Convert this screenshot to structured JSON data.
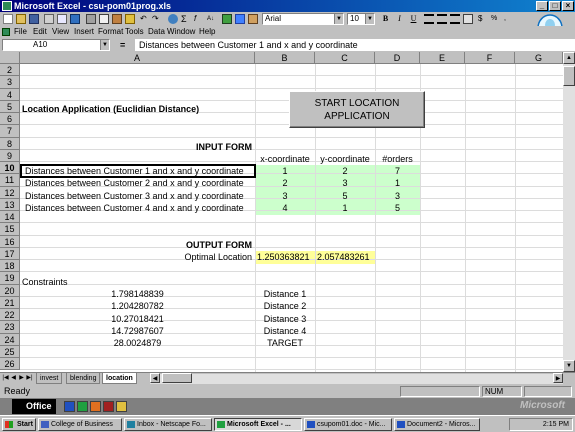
{
  "window": {
    "title": "Microsoft Excel - csu-pom01prog.xls"
  },
  "toolbar": {
    "font_name": "Arial",
    "font_size": "10",
    "bold": "B",
    "italic": "I",
    "underline": "U"
  },
  "menu": {
    "items": [
      "File",
      "Edit",
      "View",
      "Insert",
      "Format",
      "Tools",
      "Data",
      "Window",
      "Help"
    ]
  },
  "formula_bar": {
    "name_box": "A10",
    "equals": "=",
    "content": "Distances between Customer 1 and x and y coordinate"
  },
  "columns": [
    "A",
    "B",
    "C",
    "D",
    "E",
    "F",
    "G"
  ],
  "rows": [
    "2",
    "3",
    "4",
    "5",
    "6",
    "7",
    "8",
    "9",
    "10",
    "11",
    "12",
    "13",
    "14",
    "15",
    "16",
    "17",
    "18",
    "19",
    "20",
    "21",
    "22",
    "23",
    "24",
    "25",
    "26"
  ],
  "sheet": {
    "title": "Location Application (Euclidian Distance)",
    "start_button": [
      "START LOCATION",
      "APPLICATION"
    ],
    "input_form_label": "INPUT FORM",
    "input_headers": [
      "x-coordinate",
      "y-coordinate",
      "#orders"
    ],
    "input_rows": [
      {
        "label": "Distances between Customer 1 and x and y coordinate",
        "x": "1",
        "y": "2",
        "orders": "7"
      },
      {
        "label": "Distances between Customer 2 and x and y coordinate",
        "x": "2",
        "y": "3",
        "orders": "1"
      },
      {
        "label": "Distances between Customer 3 and x and y coordinate",
        "x": "3",
        "y": "5",
        "orders": "3"
      },
      {
        "label": "Distances between Customer 4 and x and y coordinate",
        "x": "4",
        "y": "1",
        "orders": "5"
      }
    ],
    "output_form_label": "OUTPUT FORM",
    "optimal_label": "Optimal Location",
    "optimal_x": "1.250363821",
    "optimal_y": "2.057483261",
    "constraints_label": "Constraints",
    "constraints": [
      {
        "value": "1.798148839",
        "name": "Distance 1"
      },
      {
        "value": "1.204280782",
        "name": "Distance  2"
      },
      {
        "value": "10.27018421",
        "name": "Distance 3"
      },
      {
        "value": "14.72987607",
        "name": "Distance 4"
      },
      {
        "value": "28.0024879",
        "name": "TARGET"
      }
    ]
  },
  "tabs": [
    "invest",
    "blending",
    "location"
  ],
  "status": {
    "left": "Ready",
    "num": "NUM"
  },
  "office_bar": {
    "label": "Office",
    "brand": "Microsoft"
  },
  "taskbar": {
    "start": "Start",
    "tasks": [
      "College of Business",
      "Inbox - Netscape Fo...",
      "Microsoft Excel - ...",
      "csupom01.doc - Mic...",
      "Document2 - Micros..."
    ],
    "clock": "2:15 PM"
  }
}
